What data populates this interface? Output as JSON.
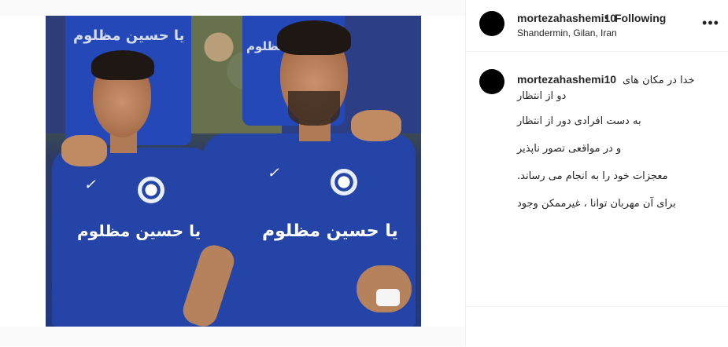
{
  "post": {
    "image": {
      "alt_text_icons": "photo",
      "chest_text": "یا حسین مظلوم",
      "brand_mark": "✓"
    },
    "header": {
      "username": "mortezahashemi10",
      "separator": "•",
      "follow_state": "Following",
      "location": "Shandermin, Gilan, Iran",
      "more_icon": "•••"
    },
    "caption": {
      "username": "mortezahashemi10",
      "first_line": "خدا در مکان های دو از انتظار",
      "lines": [
        "به دست افرادی دور از انتظار",
        "و در مواقعی تصور ناپذیر",
        "معجزات خود را به انجام می رساند.",
        "برای آن مهربان توانا ، غیرممکن وجود"
      ]
    }
  },
  "colors": {
    "accent": "#262626",
    "border": "#efefef",
    "jersey_blue": "#2444a8",
    "avatar": "#000000"
  }
}
